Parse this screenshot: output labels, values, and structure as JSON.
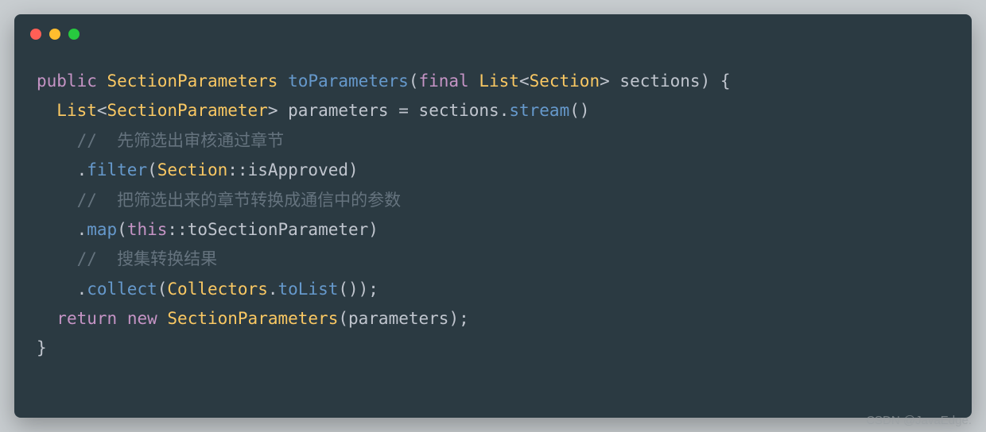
{
  "window": {
    "dots": [
      "red",
      "yellow",
      "green"
    ]
  },
  "code": {
    "line1": {
      "kw_public": "public",
      "type1": "SectionParameters",
      "fn": "toParameters",
      "kw_final": "final",
      "type2": "List",
      "generic": "Section",
      "param": "sections"
    },
    "line2": {
      "type1": "List",
      "generic": "SectionParameter",
      "var": "parameters",
      "eq": "=",
      "obj": "sections",
      "call": "stream"
    },
    "line3": {
      "comment": "//  先筛选出审核通过章节"
    },
    "line4": {
      "fn": "filter",
      "cls": "Section",
      "method": "isApproved"
    },
    "line5": {
      "comment": "//  把筛选出来的章节转换成通信中的参数"
    },
    "line6": {
      "fn": "map",
      "this": "this",
      "method": "toSectionParameter"
    },
    "line7": {
      "comment": "//  搜集转换结果"
    },
    "line8": {
      "fn": "collect",
      "cls": "Collectors",
      "method": "toList"
    },
    "line9": {
      "kw": "return",
      "kw_new": "new",
      "type": "SectionParameters",
      "arg": "parameters"
    }
  },
  "watermark": "CSDN @JavaEdge."
}
